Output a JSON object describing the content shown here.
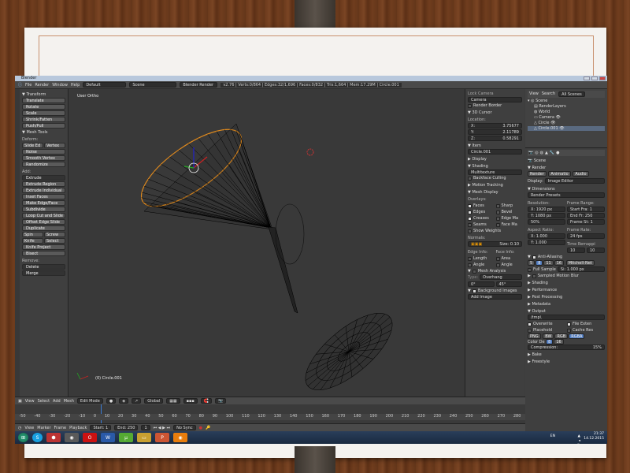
{
  "window": {
    "title": "Blender"
  },
  "info_header": {
    "menus": [
      "File",
      "Render",
      "Window",
      "Help"
    ],
    "layout": "Default",
    "scene": "Scene",
    "engine": "Blender Render",
    "stats": "v2.76 | Verts:0/864 | Edges:32/1,696 | Faces:0/832 | Tris:1,664 | Mem:17.29M | Circle.001"
  },
  "toolshelf": {
    "transform_header": "Transform",
    "transform": [
      "Translate",
      "Rotate",
      "Scale",
      "Shrink/Fatten",
      "Push/Pull"
    ],
    "mesh_tools_header": "Mesh Tools",
    "deform_label": "Deform:",
    "slide_edge": "Slide Ed",
    "vertex": "Vertex",
    "deform": [
      "Noise",
      "Smooth Vertex",
      "Randomize"
    ],
    "add_label": "Add:",
    "extrude": "Extrude",
    "add": [
      "Extrude Region",
      "Extrude Individual",
      "Inset Faces",
      "Make Edge/Face",
      "Subdivide",
      "Loop Cut and Slide",
      "Offset Edge Slide",
      "Duplicate"
    ],
    "spin": "Spin",
    "screw": "Screw",
    "knife": "Knife",
    "select": "Select",
    "add2": [
      "Knife Project",
      "Bisect"
    ],
    "remove_label": "Remove:",
    "delete": "Delete",
    "merge": "Merge"
  },
  "viewport": {
    "view_label": "User Ortho",
    "object_label": "(0) Circle.001"
  },
  "npanel": {
    "lock_camera": "Lock Camera",
    "camera": "Camera",
    "render_border": "Render Border",
    "cursor_header": "3D Cursor",
    "location_label": "Location:",
    "x": "X:",
    "x_val": "3.75677",
    "y": "Y:",
    "y_val": "2.11789",
    "z": "Z:",
    "z_val": "0.58291",
    "item_header": "Item",
    "item_name": "Circle.001",
    "display_header": "Display",
    "shading_header": "Shading",
    "shading_mode": "Multitexture",
    "backface": "Backface Culling",
    "motion_tracking": "Motion Tracking",
    "mesh_display_header": "Mesh Display",
    "overlays_label": "Overlays:",
    "overlays": [
      [
        "Faces",
        "Sharp"
      ],
      [
        "Edges",
        "Bevel"
      ],
      [
        "Creases",
        "Edge Ma"
      ],
      [
        "Seams",
        "Face Ma"
      ]
    ],
    "show_weights": "Show Weights",
    "normals_label": "Normals:",
    "size": "Size: 0.10",
    "edge_info": "Edge Info:",
    "face_info": "Face Info:",
    "length": "Length",
    "area": "Area",
    "angle": "Angle",
    "angle2": "Angle",
    "mesh_analysis": "Mesh Analysis",
    "type_label": "Type:",
    "type_val": "Overhang",
    "deg0": "0°",
    "deg45": "45°",
    "background_images": "Background Images",
    "add_image": "Add Image"
  },
  "outliner": {
    "view": "View",
    "search": "Search",
    "all_scenes": "All Scenes",
    "items": [
      "Scene",
      "RenderLayers",
      "World",
      "Camera",
      "Circle",
      "Circle.001"
    ]
  },
  "properties": {
    "scene": "Scene",
    "render_header": "Render",
    "render_btn": "Render",
    "animation_btn": "Animatio",
    "audio_btn": "Audio",
    "display_label": "Display:",
    "display_val": "Image Editor",
    "dimensions_header": "Dimensions",
    "render_presets": "Render Presets",
    "resolution": "Resolution:",
    "frame_range": "Frame Range:",
    "res_x": "X: 1920 px",
    "res_y": "Y: 1080 px",
    "res_pct": "50%",
    "start_fr": "Start Fra: 1",
    "end_fr": "End Fr: 250",
    "frame_step": "Frame St: 1",
    "aspect": "Aspect Ratio:",
    "frame_rate": "Frame Rate:",
    "asp_x": "X: 1.000",
    "asp_y": "Y: 1.000",
    "fps": "24 fps",
    "time_remap": "Time Remappi",
    "tr_a": "10",
    "tr_b": "10",
    "aa_header": "Anti-Aliasing",
    "aa_samples": [
      "5",
      "8",
      "11",
      "16"
    ],
    "aa_filter": "Mitchell-Net",
    "full_sample": "Full Sample",
    "filter_size": "Si: 1.000 px",
    "sampled_motion": "Sampled Motion Blur",
    "collapsed": [
      "Shading",
      "Performance",
      "Post Processing",
      "Metadata"
    ],
    "output_header": "Output",
    "output_path": "/tmp\\",
    "overwrite": "Overwrite",
    "file_ext": "File Exten",
    "placeholders": "Placehold",
    "cache_res": "Cache Res",
    "format": "PNG",
    "bw": "BW",
    "rgb": "RGB",
    "rgba": "RGBA",
    "color_depth": "Color De",
    "cd8": "8",
    "cd16": "16",
    "compression": "Compression:",
    "compression_val": "15%",
    "bake": "Bake",
    "freestyle": "Freestyle"
  },
  "viewport_header": {
    "view": "View",
    "select": "Select",
    "add": "Add",
    "mesh": "Mesh",
    "mode": "Edit Mode",
    "pivot": "Global"
  },
  "timeline": {
    "ticks": [
      "-50",
      "-40",
      "-30",
      "-20",
      "-10",
      "0",
      "10",
      "20",
      "30",
      "40",
      "50",
      "60",
      "70",
      "80",
      "90",
      "100",
      "110",
      "120",
      "130",
      "140",
      "150",
      "160",
      "170",
      "180",
      "190",
      "200",
      "210",
      "220",
      "230",
      "240",
      "250",
      "260",
      "270",
      "280"
    ],
    "view": "View",
    "marker": "Marker",
    "frame": "Frame",
    "playback": "Playback",
    "start": "Start:",
    "start_val": "1",
    "end": "End:",
    "end_val": "250",
    "current": "1",
    "sync": "No Sync"
  },
  "taskbar": {
    "lang": "EN",
    "time": "21:37",
    "date": "14.12.2015"
  }
}
